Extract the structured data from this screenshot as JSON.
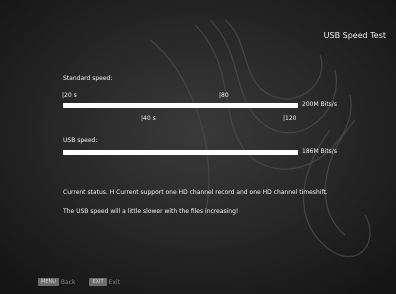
{
  "header": {
    "title": "USB Speed Test"
  },
  "standard": {
    "label": "Standard speed:",
    "ticks_top": [
      "|20 s",
      "|80"
    ],
    "ticks_bottom": [
      "|40 s",
      "|120"
    ],
    "speed": "200M Bits/s",
    "fill_fraction": 1.0
  },
  "usb": {
    "label": "USB speed:",
    "speed": "186M Bits/s",
    "fill_fraction": 1.0
  },
  "status": {
    "line1": "Current status. H Current support one HD channel record and one HD channel timeshift.",
    "line2": "The USB speed will a little slower with the files increasing!"
  },
  "footer": {
    "menu_key": "MENU",
    "menu_label": "Back",
    "exit_key": "EXIT",
    "exit_label": "Exit"
  },
  "colors": {
    "background": "#2b2b2b",
    "bar": "#dcdcdc",
    "text": "#f2f2f2"
  }
}
